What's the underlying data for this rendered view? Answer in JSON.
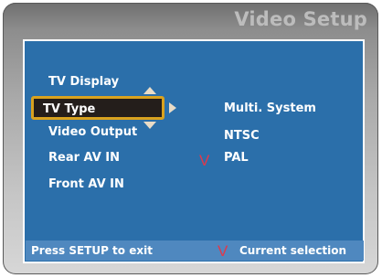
{
  "page_title": "Video Setup",
  "menu": {
    "items": [
      "TV Display",
      "TV Type",
      "Video Output",
      "Rear AV IN",
      "Front AV IN"
    ],
    "selected_label": "TV Type"
  },
  "options": {
    "items": [
      "Multi. System",
      "NTSC",
      "PAL"
    ],
    "current": "PAL"
  },
  "icons": {
    "check_mark": "V",
    "scroll_up": "triangle-up-icon",
    "scroll_down": "triangle-down-icon",
    "submenu_arrow": "triangle-right-icon"
  },
  "footer": {
    "hint": "Press SETUP to exit",
    "legend_mark": "V",
    "legend_text": "Current  selection"
  },
  "colors": {
    "panel": "#2b6faa",
    "footer": "#4f88bf",
    "highlight_border": "#d9a21f",
    "highlight_fill": "#241e1b",
    "check_mark": "#e0394b"
  }
}
